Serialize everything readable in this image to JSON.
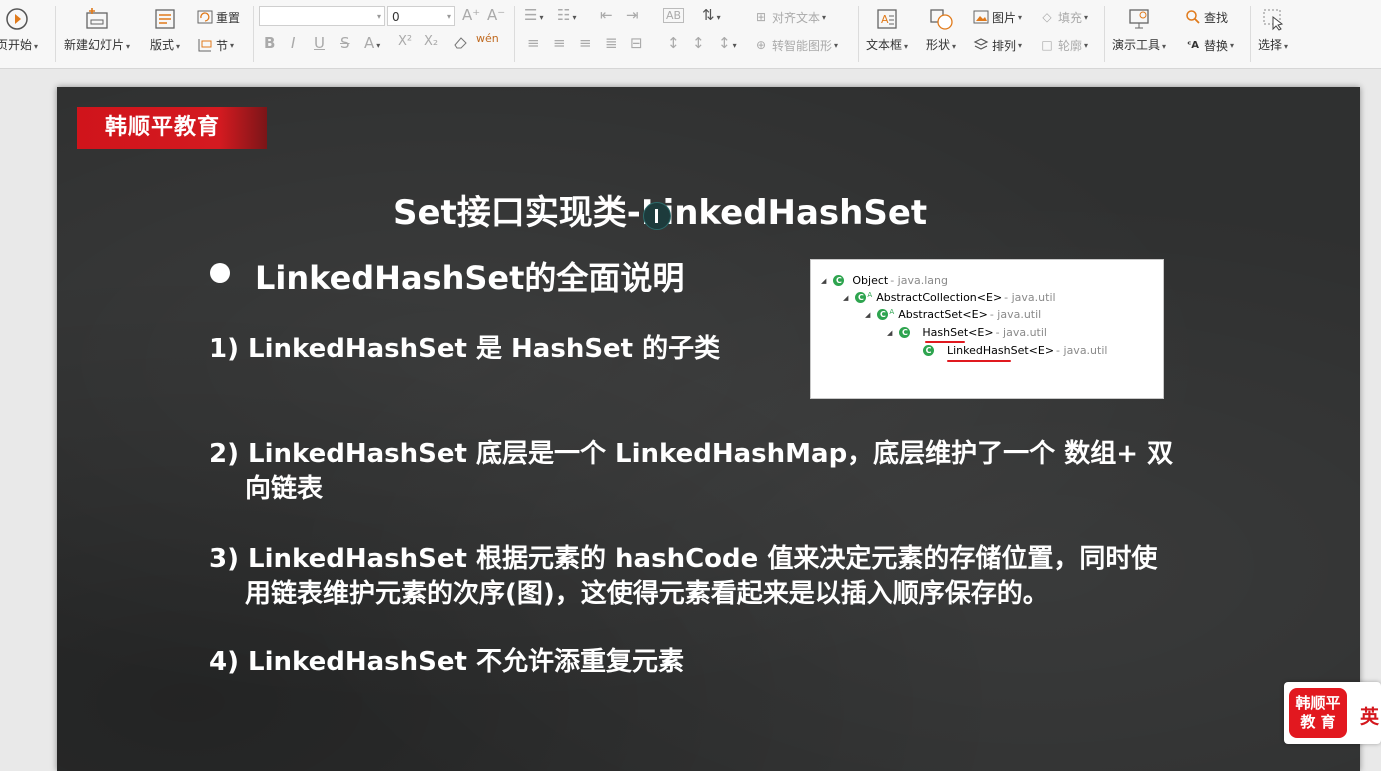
{
  "toolbar": {
    "slideshow_label": "页开始",
    "new_slide_label": "新建幻灯片",
    "layout_label": "版式",
    "reset_label": "重置",
    "section_label": "节",
    "font_size_value": "0",
    "align_text_label": "对齐文本",
    "smartart_label": "转智能图形",
    "textbox_label": "文本框",
    "shape_label": "形状",
    "picture_label": "图片",
    "fill_label": "填充",
    "arrange_label": "排列",
    "outline_label": "轮廓",
    "presenter_tools_label": "演示工具",
    "find_label": "查找",
    "replace_label": "替换",
    "select_label": "选择",
    "format_glyphs": {
      "bold": "B",
      "italic": "I",
      "underline": "U",
      "strike": "S",
      "superscript": "X²",
      "subscript": "X₂",
      "pinyin": "wén",
      "font_grow": "A⁺",
      "font_shrink": "A⁻"
    }
  },
  "slide": {
    "brand": "韩顺平教育",
    "title": "Set接口实现类-LinkedHashSet",
    "bullet": "LinkedHashSet的全面说明",
    "points": [
      {
        "line1": "1) LinkedHashSet 是 HashSet 的子类",
        "line2": ""
      },
      {
        "line1": "2) LinkedHashSet 底层是一个 LinkedHashMap，底层维护了一个 数组+ 双",
        "line2": "向链表"
      },
      {
        "line1": "3) LinkedHashSet 根据元素的 hashCode 值来决定元素的存储位置，同时使",
        "line2": "用链表维护元素的次序(图)，这使得元素看起来是以插入顺序保存的。"
      },
      {
        "line1": "4) LinkedHashSet 不允许添重复元素",
        "line2": ""
      }
    ],
    "hierarchy": [
      {
        "name": "Object",
        "pkg": "- java.lang",
        "abstract": false
      },
      {
        "name": "AbstractCollection<E>",
        "pkg": "- java.util",
        "abstract": true
      },
      {
        "name": "AbstractSet<E>",
        "pkg": "- java.util",
        "abstract": true
      },
      {
        "name": "HashSet<E>",
        "pkg": "- java.util",
        "abstract": false
      },
      {
        "name": "LinkedHashSet<E>",
        "pkg": "- java.util",
        "abstract": false
      }
    ],
    "class_badge": "C",
    "abstract_badge": "A"
  },
  "corner": {
    "logo_line1": "韩顺平",
    "logo_line2": "教 育",
    "ime_label": "英"
  },
  "colors": {
    "brand_red": "#d0141b",
    "slide_bg": "#2f3030",
    "class_green": "#2ea44f",
    "underline_red": "#e0191f"
  }
}
